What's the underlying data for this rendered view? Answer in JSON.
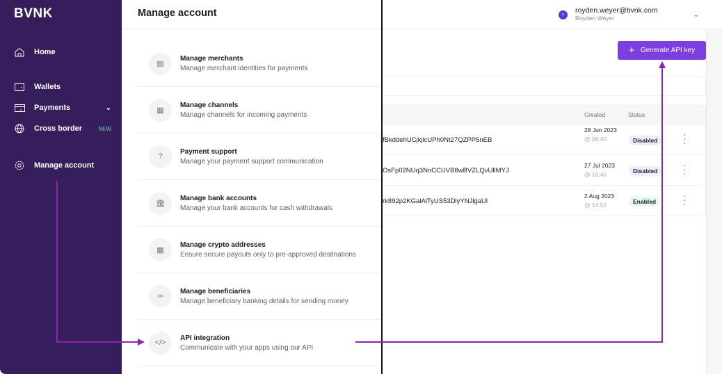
{
  "sidebar": {
    "logo": "BVNK",
    "items": [
      {
        "label": "Home",
        "icon": "home-icon"
      },
      {
        "label": "Wallets",
        "icon": "wallet-icon"
      },
      {
        "label": "Payments",
        "icon": "card-icon"
      },
      {
        "label": "Cross border",
        "icon": "globe-icon",
        "badge": "NEW"
      },
      {
        "label": "Manage account",
        "icon": "gear-icon"
      }
    ]
  },
  "header": {
    "title": "Manage account",
    "user_email": "royden.weyer@bvnk.com",
    "user_name": "Royden Weyer",
    "avatar_initial": "r"
  },
  "menu": [
    {
      "title": "Manage merchants",
      "desc": "Manage merchant identities for payments",
      "icon": "store-icon"
    },
    {
      "title": "Manage channels",
      "desc": "Manage channels for incoming payments",
      "icon": "qr-icon"
    },
    {
      "title": "Payment support",
      "desc": "Manage your payment support communication",
      "icon": "question-icon"
    },
    {
      "title": "Manage bank accounts",
      "desc": "Manage your bank accounts for cash withdrawals",
      "icon": "bank-icon"
    },
    {
      "title": "Manage crypto addresses",
      "desc": "Ensure secure payouts only to pre-approved destinations",
      "icon": "qr-icon"
    },
    {
      "title": "Manage beneficiaries",
      "desc": "Manage beneficiary banking details for sending money",
      "icon": "people-icon"
    },
    {
      "title": "API integration",
      "desc": "Communicate with your apps using our API",
      "icon": "code-icon"
    }
  ],
  "actions": {
    "generate_label": "Generate API key"
  },
  "table": {
    "headers": {
      "created": "Created",
      "status": "Status"
    },
    "rows": [
      {
        "key": "fBkddehUCjkjlcUPh0Nt27QZPP5nEB",
        "date": "28 Jun 2023",
        "time": "@ 08:40",
        "status": "Disabled"
      },
      {
        "key": "OsFp02NUq3NnCCUVB8wBVZLQvUllMYJ",
        "date": "27 Jul 2023",
        "time": "@ 16:46",
        "status": "Disabled"
      },
      {
        "key": "rk892p2KGalAlTyUS53DlyYNJlgaUl",
        "date": "2 Aug 2023",
        "time": "@ 14:52",
        "status": "Enabled"
      }
    ]
  },
  "colors": {
    "sidebar": "#361d5b",
    "accent": "#7b3fe0",
    "annotation": "#8e24aa",
    "disabled_bg": "#eceffa",
    "enabled_bg": "#e6f6f1"
  }
}
